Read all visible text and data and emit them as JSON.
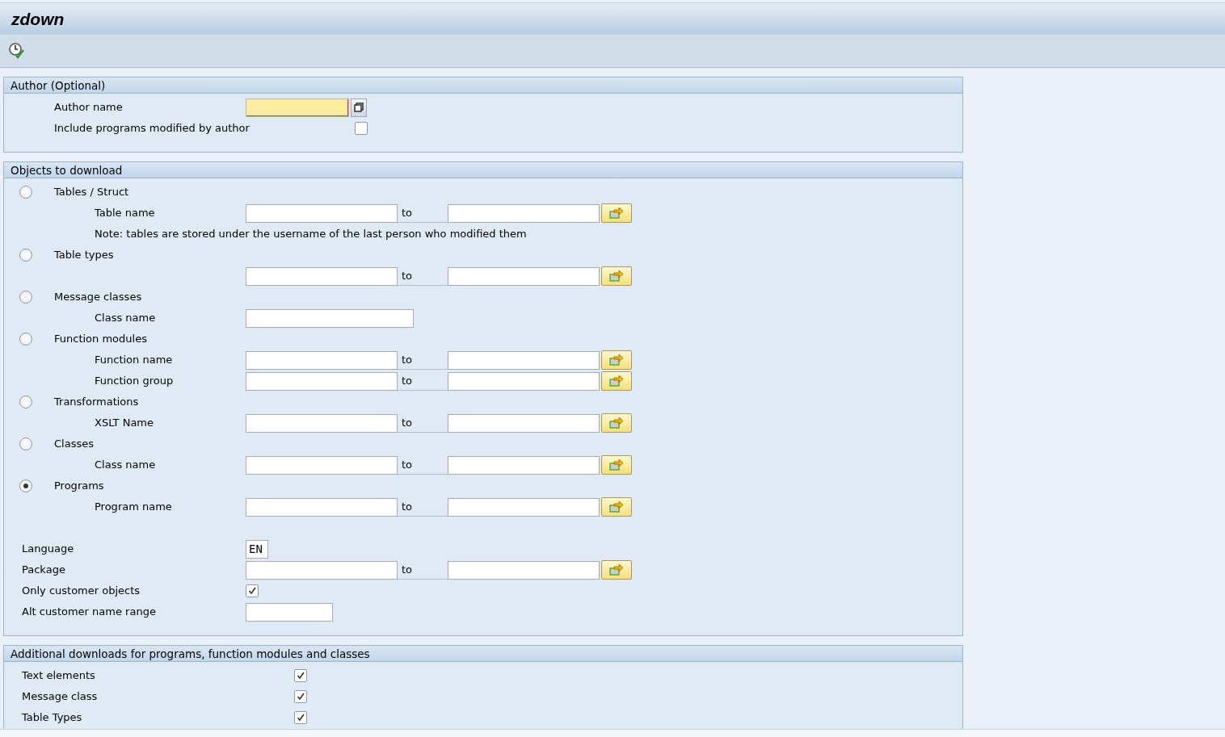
{
  "window": {
    "title": "zdown"
  },
  "sections": [
    {
      "kind": "author",
      "title": "Author (Optional)",
      "rows": [
        {
          "kind": "lookup_field",
          "label": "Author name",
          "focused": true
        },
        {
          "kind": "checkbox",
          "label": "Include programs modified by author",
          "checked": false
        }
      ]
    },
    {
      "kind": "objects",
      "title": "Objects to download",
      "rows": [
        {
          "kind": "radio",
          "label": "Tables / Struct",
          "selected": false,
          "children": [
            {
              "kind": "range",
              "label": "Table name",
              "to": "to"
            },
            {
              "kind": "note",
              "text": "Note: tables are stored under the username of the last person who modified them"
            }
          ]
        },
        {
          "kind": "radio",
          "label": "Table types",
          "selected": false,
          "children": [
            {
              "kind": "range",
              "to": "to"
            }
          ]
        },
        {
          "kind": "radio",
          "label": "Message classes",
          "selected": false,
          "children": [
            {
              "kind": "field",
              "label": "Class name"
            }
          ]
        },
        {
          "kind": "radio",
          "label": "Function modules",
          "selected": false,
          "children": [
            {
              "kind": "range",
              "label": "Function name",
              "to": "to"
            },
            {
              "kind": "range",
              "label": "Function group",
              "to": "to"
            }
          ]
        },
        {
          "kind": "radio",
          "label": "Transformations",
          "selected": false,
          "children": [
            {
              "kind": "range",
              "label": "XSLT Name",
              "to": "to"
            }
          ]
        },
        {
          "kind": "radio",
          "label": "Classes",
          "selected": false,
          "children": [
            {
              "kind": "range",
              "label": "Class name",
              "to": "to"
            }
          ]
        },
        {
          "kind": "radio",
          "label": "Programs",
          "selected": true,
          "children": [
            {
              "kind": "range",
              "label": "Program name",
              "to": "to"
            }
          ]
        },
        {
          "kind": "spacer"
        },
        {
          "kind": "code_field",
          "label": "Language",
          "value": "EN"
        },
        {
          "kind": "range",
          "label": "Package",
          "to": "to"
        },
        {
          "kind": "checkbox",
          "label": "Only customer objects",
          "checked": true
        },
        {
          "kind": "short_field",
          "label": "Alt customer name range"
        }
      ]
    },
    {
      "kind": "extras",
      "title": "Additional downloads for programs, function modules and classes",
      "rows": [
        {
          "kind": "checkbox",
          "label": "Text elements",
          "checked": true
        },
        {
          "kind": "checkbox",
          "label": "Message class",
          "checked": true
        },
        {
          "kind": "checkbox",
          "label": "Table Types",
          "checked": true
        }
      ]
    }
  ]
}
